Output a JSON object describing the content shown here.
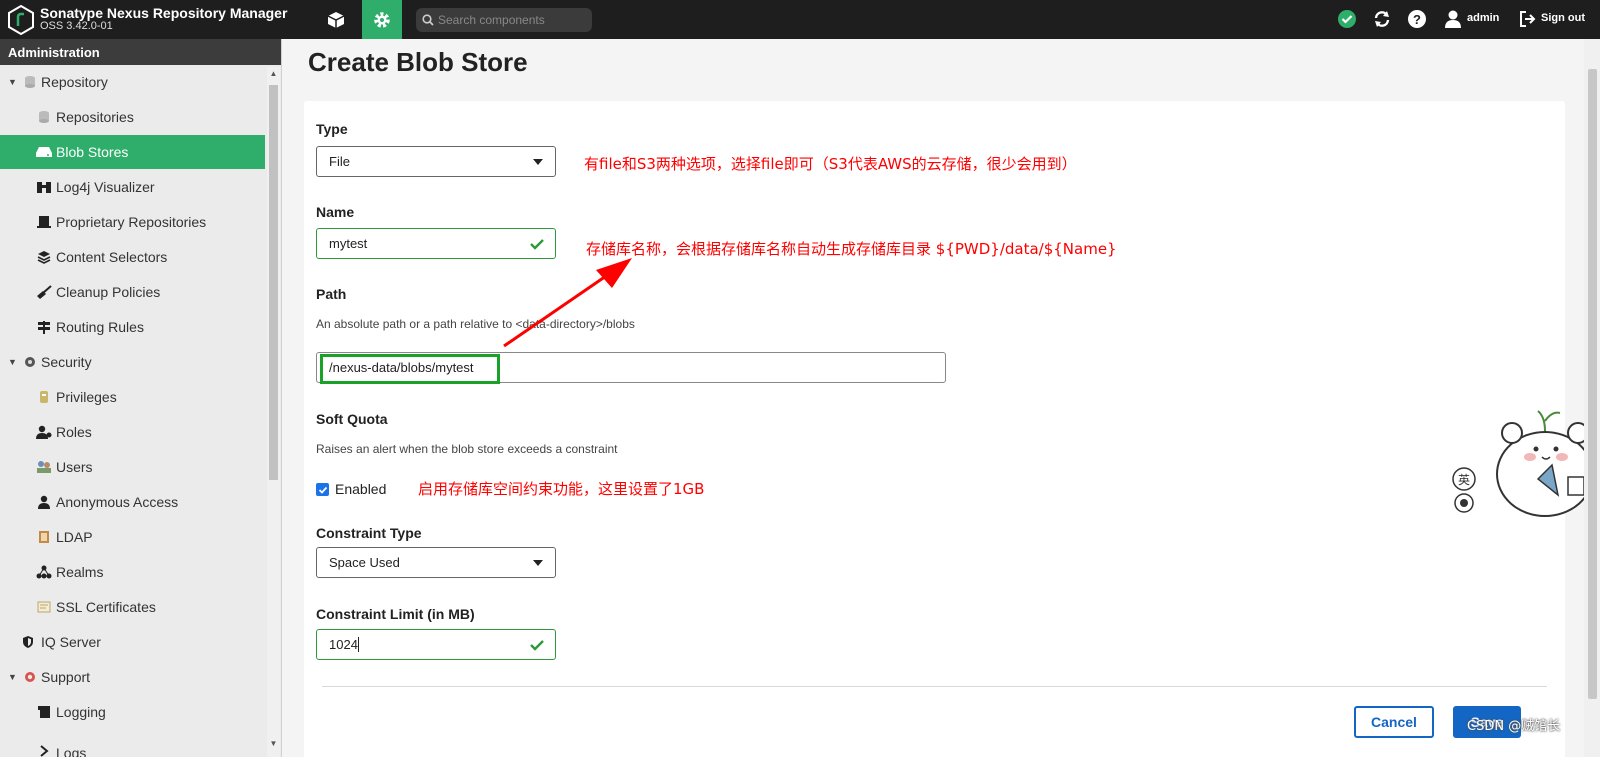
{
  "header": {
    "app_title": "Sonatype Nexus Repository Manager",
    "version": "OSS 3.42.0-01",
    "search_placeholder": "Search components",
    "user": "admin",
    "signout": "Sign out"
  },
  "sidebar": {
    "heading": "Administration",
    "items": [
      {
        "label": "Repository",
        "icon": "database-icon",
        "group": true
      },
      {
        "label": "Repositories",
        "icon": "database-icon"
      },
      {
        "label": "Blob Stores",
        "icon": "hard-drive-icon",
        "selected": true
      },
      {
        "label": "Log4j Visualizer",
        "icon": "binoculars-icon"
      },
      {
        "label": "Proprietary Repositories",
        "icon": "id-badge-icon"
      },
      {
        "label": "Content Selectors",
        "icon": "layers-icon"
      },
      {
        "label": "Cleanup Policies",
        "icon": "broom-icon"
      },
      {
        "label": "Routing Rules",
        "icon": "signpost-icon"
      },
      {
        "label": "Security",
        "icon": "shield-icon",
        "group": true
      },
      {
        "label": "Privileges",
        "icon": "key-icon"
      },
      {
        "label": "Roles",
        "icon": "user-gear-icon"
      },
      {
        "label": "Users",
        "icon": "users-icon"
      },
      {
        "label": "Anonymous Access",
        "icon": "user-icon"
      },
      {
        "label": "LDAP",
        "icon": "book-icon"
      },
      {
        "label": "Realms",
        "icon": "sitemap-icon"
      },
      {
        "label": "SSL Certificates",
        "icon": "certificate-icon"
      },
      {
        "label": "IQ Server",
        "icon": "shield-icon"
      },
      {
        "label": "Support",
        "icon": "lifebuoy-icon",
        "group": true
      },
      {
        "label": "Logging",
        "icon": "log-icon"
      },
      {
        "label": "Logs",
        "icon": "chevron-right-icon"
      }
    ]
  },
  "main": {
    "title": "Create Blob Store",
    "type_label": "Type",
    "type_value": "File",
    "name_label": "Name",
    "name_value": "mytest",
    "path_label": "Path",
    "path_help": "An absolute path or a path relative to <data-directory>/blobs",
    "path_value": "/nexus-data/blobs/mytest",
    "soft_quota_label": "Soft Quota",
    "soft_quota_help": "Raises an alert when the blob store exceeds a constraint",
    "enabled_label": "Enabled",
    "enabled_checked": true,
    "constraint_type_label": "Constraint Type",
    "constraint_type_value": "Space Used",
    "constraint_limit_label": "Constraint Limit (in MB)",
    "constraint_limit_value": "1024",
    "cancel": "Cancel",
    "save": "Save"
  },
  "annotations": {
    "type_note": "有file和S3两种选项，选择file即可（S3代表AWS的云存储，很少会用到）",
    "name_note": "存储库名称，会根据存储库名称自动生成存储库目录 ${PWD}/data/${Name}",
    "quota_note": "启用存储库空间约束功能，这里设置了1GB"
  },
  "watermark": "CSDN @贼馆长",
  "colors": {
    "accent": "#2fae6b",
    "primary": "#1366c4",
    "annotation": "#ff0000",
    "valid": "#2e9a3a"
  }
}
